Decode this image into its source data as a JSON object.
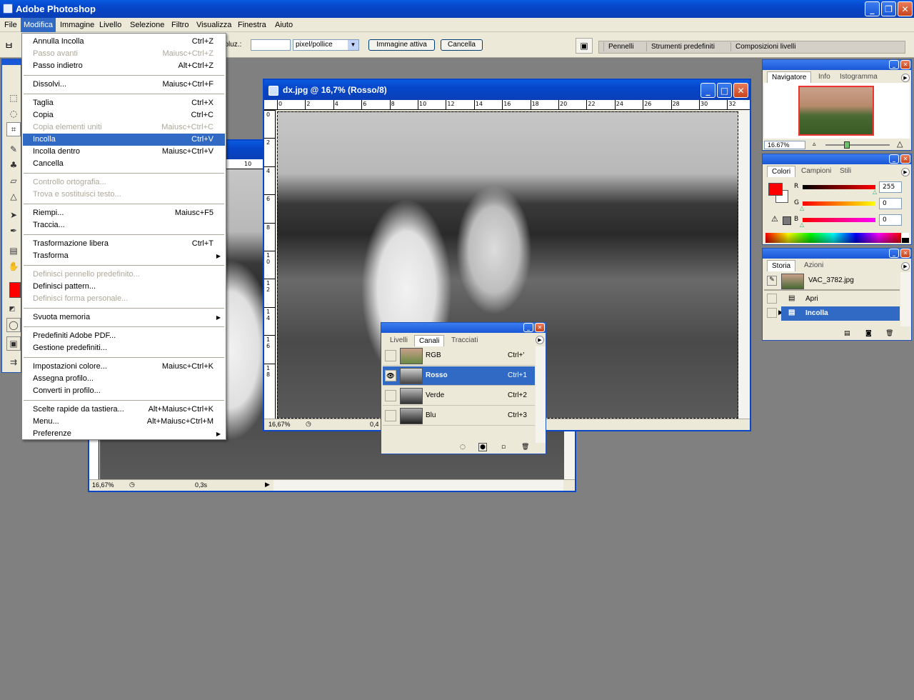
{
  "app": {
    "title": "Adobe Photoshop"
  },
  "menubar": [
    "File",
    "Modifica",
    "Immagine",
    "Livello",
    "Selezione",
    "Filtro",
    "Visualizza",
    "Finestra",
    "Aiuto"
  ],
  "options": {
    "risoluz_label": "Risoluz.:",
    "risoluz_value": "",
    "unit": "pixel/pollice",
    "front_image_btn": "Immagine attiva",
    "clear_btn": "Cancella",
    "well_tabs": [
      "Pennelli",
      "Strumenti predefiniti",
      "Composizioni livelli"
    ]
  },
  "edit_menu": [
    {
      "label": "Annulla Incolla",
      "shortcut": "Ctrl+Z",
      "disabled": false
    },
    {
      "label": "Passo avanti",
      "shortcut": "Maiusc+Ctrl+Z",
      "disabled": true
    },
    {
      "label": "Passo indietro",
      "shortcut": "Alt+Ctrl+Z",
      "disabled": false
    },
    {
      "sep": true
    },
    {
      "label": "Dissolvi...",
      "shortcut": "Maiusc+Ctrl+F",
      "disabled": false
    },
    {
      "sep": true
    },
    {
      "label": "Taglia",
      "shortcut": "Ctrl+X",
      "disabled": false
    },
    {
      "label": "Copia",
      "shortcut": "Ctrl+C",
      "disabled": false
    },
    {
      "label": "Copia elementi uniti",
      "shortcut": "Maiusc+Ctrl+C",
      "disabled": true
    },
    {
      "label": "Incolla",
      "shortcut": "Ctrl+V",
      "disabled": false,
      "selected": true
    },
    {
      "label": "Incolla dentro",
      "shortcut": "Maiusc+Ctrl+V",
      "disabled": false
    },
    {
      "label": "Cancella",
      "shortcut": "",
      "disabled": false
    },
    {
      "sep": true
    },
    {
      "label": "Controllo ortografia...",
      "shortcut": "",
      "disabled": true
    },
    {
      "label": "Trova e sostituisci testo...",
      "shortcut": "",
      "disabled": true
    },
    {
      "sep": true
    },
    {
      "label": "Riempi...",
      "shortcut": "Maiusc+F5",
      "disabled": false
    },
    {
      "label": "Traccia...",
      "shortcut": "",
      "disabled": false
    },
    {
      "sep": true
    },
    {
      "label": "Trasformazione libera",
      "shortcut": "Ctrl+T",
      "disabled": false
    },
    {
      "label": "Trasforma",
      "shortcut": "",
      "disabled": false,
      "submenu": true
    },
    {
      "sep": true
    },
    {
      "label": "Definisci pennello predefinito...",
      "shortcut": "",
      "disabled": true
    },
    {
      "label": "Definisci pattern...",
      "shortcut": "",
      "disabled": false
    },
    {
      "label": "Definisci forma personale...",
      "shortcut": "",
      "disabled": true
    },
    {
      "sep": true
    },
    {
      "label": "Svuota memoria",
      "shortcut": "",
      "disabled": false,
      "submenu": true
    },
    {
      "sep": true
    },
    {
      "label": "Predefiniti Adobe PDF...",
      "shortcut": "",
      "disabled": false
    },
    {
      "label": "Gestione predefiniti...",
      "shortcut": "",
      "disabled": false
    },
    {
      "sep": true
    },
    {
      "label": "Impostazioni colore...",
      "shortcut": "Maiusc+Ctrl+K",
      "disabled": false
    },
    {
      "label": "Assegna profilo...",
      "shortcut": "",
      "disabled": false
    },
    {
      "label": "Converti in profilo...",
      "shortcut": "",
      "disabled": false
    },
    {
      "sep": true
    },
    {
      "label": "Scelte rapide da tastiera...",
      "shortcut": "Alt+Maiusc+Ctrl+K",
      "disabled": false
    },
    {
      "label": "Menu...",
      "shortcut": "Alt+Maiusc+Ctrl+M",
      "disabled": false
    },
    {
      "label": "Preferenze",
      "shortcut": "",
      "disabled": false,
      "submenu": true
    }
  ],
  "doc_main": {
    "title": "dx.jpg @ 16,7% (Rosso/8)",
    "zoom": "16,67%",
    "status": "0,4",
    "ruler_top": [
      "0",
      "2",
      "4",
      "6",
      "8",
      "10",
      "12",
      "14",
      "16",
      "18",
      "20",
      "22",
      "24",
      "26",
      "28",
      "30",
      "32"
    ],
    "ruler_left": [
      "0",
      "2",
      "4",
      "6",
      "8",
      "1\n0",
      "1\n2",
      "1\n4",
      "1\n6",
      "1\n8"
    ]
  },
  "doc_back": {
    "zoom": "16,67%",
    "status": "0,3s",
    "ruler_tick": "10"
  },
  "channels": {
    "tabs": [
      "Livelli",
      "Canali",
      "Tracciati"
    ],
    "rows": [
      {
        "name": "RGB",
        "shortcut": "Ctrl+'",
        "visible": false,
        "selected": false
      },
      {
        "name": "Rosso",
        "shortcut": "Ctrl+1",
        "visible": true,
        "selected": true
      },
      {
        "name": "Verde",
        "shortcut": "Ctrl+2",
        "visible": false,
        "selected": false
      },
      {
        "name": "Blu",
        "shortcut": "Ctrl+3",
        "visible": false,
        "selected": false
      }
    ]
  },
  "navigator": {
    "tabs": [
      "Navigatore",
      "Info",
      "Istogramma"
    ],
    "zoom": "16.67%"
  },
  "colors": {
    "tabs": [
      "Colori",
      "Campioni",
      "Stili"
    ],
    "r_label": "R",
    "g_label": "G",
    "b_label": "B",
    "r": "255",
    "g": "0",
    "b": "0",
    "fg": "#ff0000",
    "bg": "#ffffff"
  },
  "history": {
    "tabs": [
      "Storia",
      "Azioni"
    ],
    "snapshot": "VAC_3782.jpg",
    "items": [
      {
        "name": "Apri",
        "selected": false
      },
      {
        "name": "Incolla",
        "selected": true
      }
    ]
  }
}
